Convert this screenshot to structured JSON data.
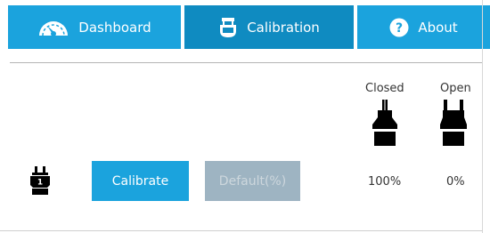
{
  "tabs": [
    {
      "label": "Dashboard",
      "icon": "gauge-icon",
      "active": false
    },
    {
      "label": "Calibration",
      "icon": "gripper-icon",
      "active": true
    },
    {
      "label": "About",
      "icon": "question-circle-icon",
      "active": false
    }
  ],
  "columns": {
    "closed": "Closed",
    "open": "Open"
  },
  "row": {
    "gripper_number": "1",
    "calibrate_label": "Calibrate",
    "default_label": "Default(%)",
    "closed_value": "100%",
    "open_value": "0%"
  },
  "colors": {
    "accent": "#1ba3dd",
    "active_tab": "#0f8bc1",
    "disabled_button": "#9eb4c2"
  }
}
